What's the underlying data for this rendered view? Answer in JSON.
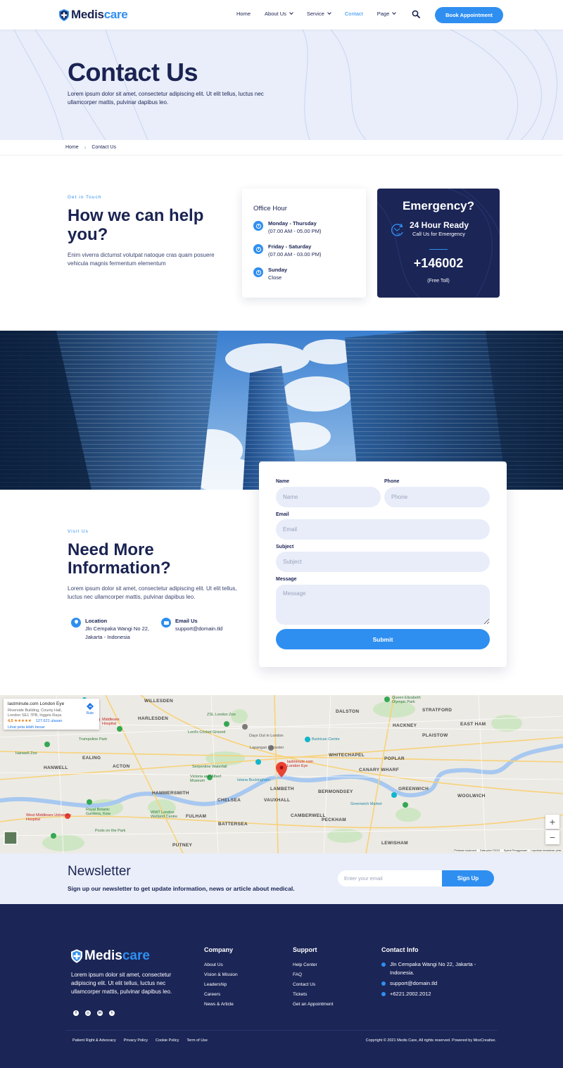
{
  "brand": {
    "name_part1": "Medis",
    "name_part2": "care"
  },
  "nav": {
    "items": [
      {
        "label": "Home"
      },
      {
        "label": "About Us"
      },
      {
        "label": "Service"
      },
      {
        "label": "Contact"
      },
      {
        "label": "Page"
      }
    ],
    "cta": "Book Appointment"
  },
  "hero": {
    "title": "Contact Us",
    "description": "Lorem ipsum dolor sit amet, consectetur adipiscing elit. Ut elit tellus, luctus nec ullamcorper mattis, pulvinar dapibus leo."
  },
  "breadcrumb": {
    "home": "Home",
    "current": "Contact Us"
  },
  "help": {
    "eyebrow": "Get in Touch",
    "title": "How we can help you?",
    "description": "Enim viverra dictumst volutpat natoque cras quam posuere vehicula magnis fermentum elementum"
  },
  "office": {
    "title": "Office Hour",
    "rows": [
      {
        "day": "Monday - Thursday",
        "time": "(07.00 AM - 05.00 PM)"
      },
      {
        "day": "Friday - Saturday",
        "time": "(07.00 AM - 03.00 PM)"
      },
      {
        "day": "Sunday",
        "time": "Close"
      }
    ]
  },
  "emergency": {
    "title": "Emergency?",
    "ready": "24 Hour Ready",
    "sub": "Call Us for Emergency",
    "phone": "+146002",
    "toll": "(Free Toll)",
    "icon": "24-clock-icon"
  },
  "info": {
    "eyebrow": "Visit Us",
    "title": "Need More Information?",
    "description": "Lorem ipsum dolor sit amet, consectetur adipiscing elit. Ut elit tellus, luctus nec ullamcorper mattis, pulvinar dapibus leo.",
    "location_label": "Location",
    "location_value": "Jln Cempaka Wangi No 22, Jakarta - Indonesia",
    "email_label": "Email Us",
    "email_value": "support@domain.tld"
  },
  "form": {
    "name_label": "Name",
    "name_placeholder": "Name",
    "phone_label": "Phone",
    "phone_placeholder": "Phone",
    "email_label": "Email",
    "email_placeholder": "Email",
    "subject_label": "Subject",
    "subject_placeholder": "Subject",
    "message_label": "Message",
    "message_placeholder": "Message",
    "submit": "Submit"
  },
  "map": {
    "place_title": "lastminute.com London Eye",
    "place_address": "Riverside Building, County Hall, London SE1 7PB, Inggris Raya",
    "rating": "4,5 ★★★★★",
    "reviews": "127.621 ulasan",
    "larger_map": "Lihat peta lebih besar",
    "route": "Rute",
    "zoom_in": "+",
    "zoom_out": "−",
    "areas": [
      "WILLESDEN",
      "HARLESDEN",
      "EALING",
      "ACTON",
      "HANWELL",
      "HAMMERSMITH",
      "CHELSEA",
      "FULHAM",
      "BATTERSEA",
      "PUTNEY",
      "LAMBETH",
      "VAUXHALL",
      "BERMONDSEY",
      "PECKHAM",
      "CAMBERWELL",
      "DALSTON",
      "HACKNEY",
      "WHITECHAPEL",
      "POPLAR",
      "CANARY WHARF",
      "GREENWICH",
      "WOOLWICH",
      "PLAISTOW",
      "EAST HAM",
      "LEWISHAM",
      "STRATFORD"
    ],
    "pois": [
      "Lord's Cricket Ground",
      "ZSL London Zoo",
      "Barbican Centre",
      "Serpentine Waterfall",
      "Victoria and Albert Museum",
      "Istana Buckingham",
      "Royal Botanic Gardens, Kew",
      "West Middlesex University Hospital",
      "Greenwich Market",
      "Queen Elizabeth Olympic Park",
      "Lapangan Leicester",
      "Days Out in London",
      "WWT London Wetland Centre",
      "Pools on the Park",
      "Middlesex Hospital",
      "Trampoline Park",
      "Hanwell Zoo",
      "lastminute.com London Eye"
    ],
    "footer": [
      "Pintasan keyboard",
      "Data peta ©2021",
      "Syarat Penggunaan",
      "Laporkan kesalahan peta"
    ]
  },
  "newsletter": {
    "title": "Newsletter",
    "description": "Sign up our newsletter to get update information, news or article about medical.",
    "placeholder": "Enter your email",
    "button": "Sign Up"
  },
  "footer": {
    "about": "Lorem ipsum dolor sit amet, consectetur adipiscing elit. Ut elit tellus, luctus nec ullamcorper mattis, pulvinar dapibus leo.",
    "social": [
      "facebook-icon",
      "instagram-icon",
      "linkedin-icon",
      "twitter-icon"
    ],
    "company_title": "Company",
    "company_links": [
      "About Us",
      "Vision & Mission",
      "Leadership",
      "Careers",
      "News & Article"
    ],
    "support_title": "Support",
    "support_links": [
      "Help Center",
      "FAQ",
      "Contact Us",
      "Tickets",
      "Get an Appointment"
    ],
    "contact_title": "Contact Info",
    "contact_address": "Jln Cempaka Wangi No 22, Jakarta - Indonesia.",
    "contact_email": "support@domain.tld",
    "contact_phone": "+6221.2002.2012",
    "bottom_links": [
      "Patient Right & Advocacy",
      "Privacy Policy",
      "Cookie Policy",
      "Term of Use"
    ],
    "copyright": "Copyright © 2021 Medis Care, All rights reserved. Powered by MoxCreative."
  },
  "colors": {
    "primary": "#2f8ff0",
    "navy": "#1b2556",
    "light_bg": "#e9eefa"
  }
}
